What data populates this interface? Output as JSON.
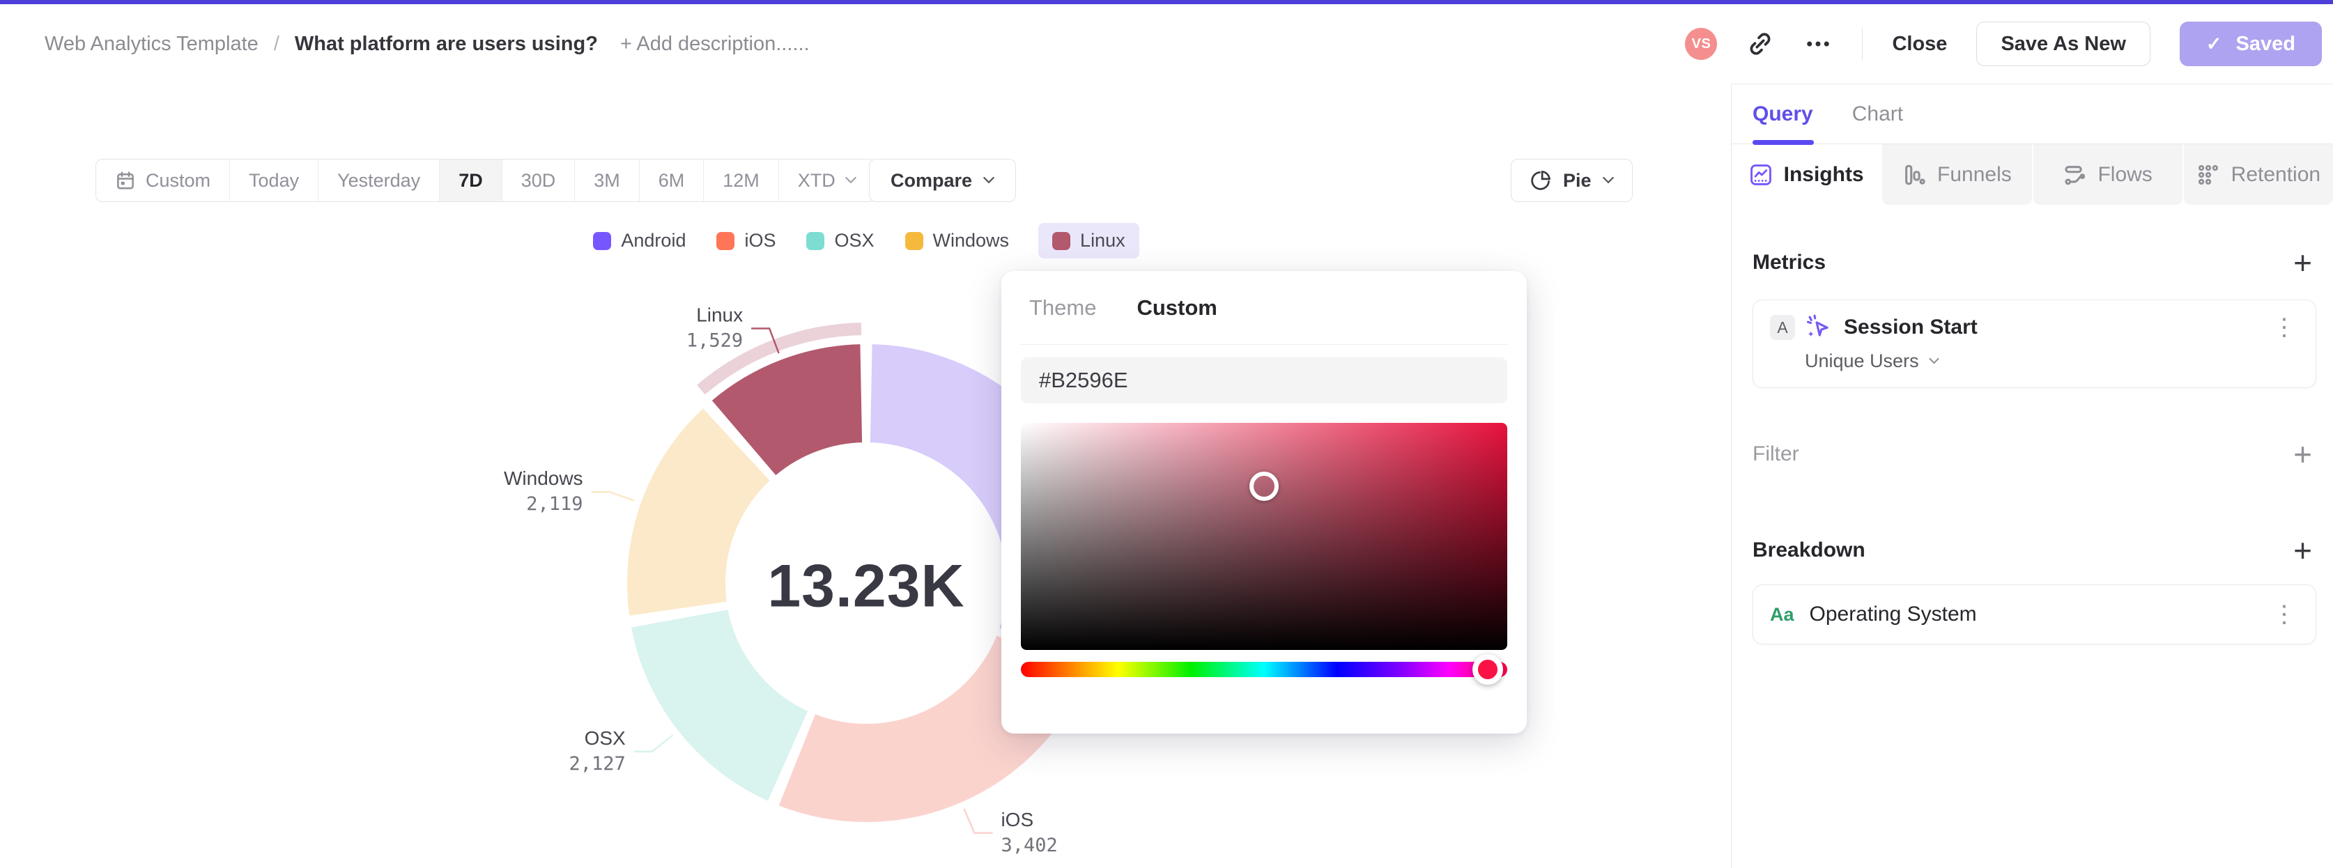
{
  "glyphs": {
    "plus": "+",
    "kebab": "⋮",
    "check": "✓"
  },
  "header": {
    "breadcrumb_root": "Web Analytics Template",
    "breadcrumb_separator": "/",
    "title": "What platform are users using?",
    "add_description": "+ Add description......",
    "avatar_initials": "VS",
    "close_label": "Close",
    "save_as_new_label": "Save As New",
    "saved_label": "Saved",
    "accent_color": "#4C3ED9",
    "avatar_color": "#F58E8E",
    "saved_button_color": "#AEA3F0"
  },
  "toolbar": {
    "ranges": [
      "Custom",
      "Today",
      "Yesterday",
      "7D",
      "30D",
      "3M",
      "6M",
      "12M",
      "XTD"
    ],
    "active_range": "7D",
    "compare_label": "Compare",
    "chart_type_label": "Pie"
  },
  "legend": {
    "items": [
      {
        "label": "Android",
        "color": "#7856FF"
      },
      {
        "label": "iOS",
        "color": "#FF7557"
      },
      {
        "label": "OSX",
        "color": "#7EDDD3"
      },
      {
        "label": "Windows",
        "color": "#F5B93E"
      },
      {
        "label": "Linux",
        "color": "#B2596E"
      }
    ],
    "highlighted": "Linux"
  },
  "chart_data": {
    "type": "pie",
    "categories": [
      "Android",
      "iOS",
      "OSX",
      "Windows",
      "Linux"
    ],
    "values": [
      4053,
      3402,
      2127,
      2119,
      1529
    ],
    "value_labels": [
      "",
      "3,402",
      "2,127",
      "2,119",
      "1,529"
    ],
    "total_label": "13.23K",
    "colors": [
      "#7856FF",
      "#FF7557",
      "#7EDDD3",
      "#F5B93E",
      "#B2596E"
    ],
    "colors_muted": [
      "#D8CCFB",
      "#FBD3CD",
      "#D9F3EE",
      "#FBE9C9",
      "#B2596E"
    ],
    "highlight_index": 4,
    "legend_position": "top",
    "donut": true
  },
  "color_picker": {
    "tabs": [
      "Theme",
      "Custom"
    ],
    "active_tab": "Custom",
    "hex_value": "#B2596E",
    "cursor_x_pct": 50,
    "cursor_y_pct": 28,
    "hue_pct": 96,
    "hue_thumb_color": "#FA1244",
    "sv_top_right_color": "#E8123D"
  },
  "panel": {
    "tabs": [
      {
        "label": "Query"
      },
      {
        "label": "Chart"
      }
    ],
    "active_tab": "Query",
    "view_tabs": [
      {
        "label": "Insights"
      },
      {
        "label": "Funnels"
      },
      {
        "label": "Flows"
      },
      {
        "label": "Retention"
      }
    ],
    "active_view": "Insights",
    "metrics": {
      "heading": "Metrics",
      "card": {
        "series_badge": "A",
        "event_name": "Session Start",
        "aggregation": "Unique Users"
      }
    },
    "filter": {
      "heading": "Filter"
    },
    "breakdown": {
      "heading": "Breakdown",
      "card": {
        "type_badge": "Aa",
        "property": "Operating System"
      }
    }
  }
}
